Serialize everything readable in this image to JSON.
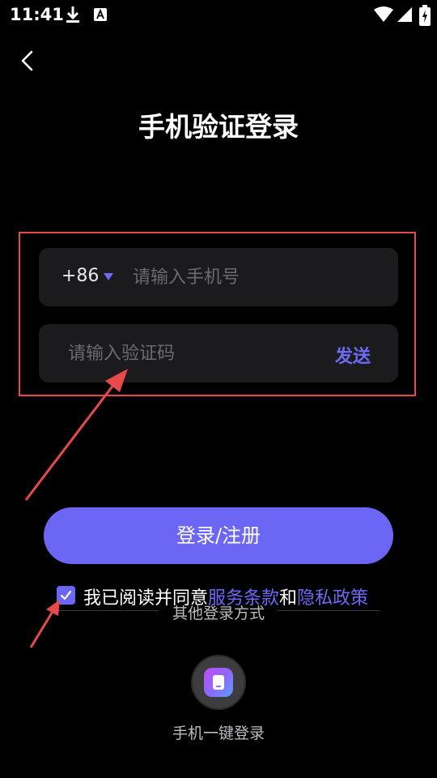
{
  "status_bar": {
    "time": "11:41",
    "icons": [
      "download-icon",
      "a-notification-icon",
      "wifi-icon",
      "signal-icon",
      "battery-charging-icon"
    ]
  },
  "header": {
    "back_icon": "chevron-left-icon",
    "title": "手机验证登录"
  },
  "phone_field": {
    "country_code": "+86",
    "dropdown_icon": "triangle-down-icon",
    "placeholder": "请输入手机号",
    "value": ""
  },
  "code_field": {
    "placeholder": "请输入验证码",
    "value": "",
    "send_label": "发送"
  },
  "login_button": {
    "label": "登录/注册"
  },
  "agreement": {
    "checked": true,
    "prefix": "我已阅读并同意",
    "terms_link": "服务条款",
    "connector": "和",
    "privacy_link": "隐私政策"
  },
  "other_login": {
    "title": "其他登录方式",
    "one_tap_label": "手机一键登录"
  },
  "colors": {
    "background": "#000000",
    "field_bg": "#1b1b1d",
    "accent": "#6c66f4",
    "link": "#6d6af7",
    "annotation_red": "#e8494a"
  }
}
